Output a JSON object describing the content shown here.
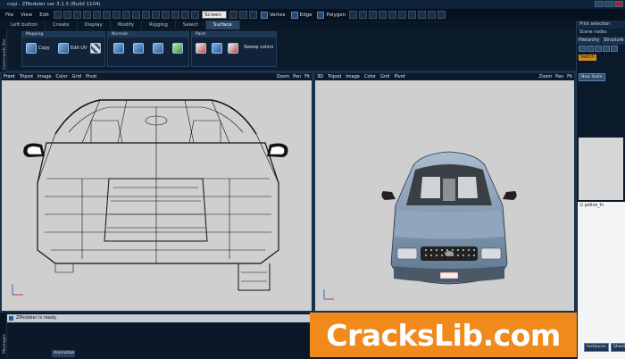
{
  "window": {
    "title": "cvpi - ZModeler ver 3.1.5 (Build 1104)"
  },
  "menu": {
    "items": [
      "File",
      "View",
      "Edit"
    ],
    "select_value": "Screen",
    "modes": [
      "Vertex",
      "Edge",
      "Polygon"
    ]
  },
  "tabs": {
    "items": [
      "Create",
      "Display",
      "Modify",
      "Rigging",
      "Select",
      "Surface"
    ],
    "active": "Surface",
    "left_button": "Left button"
  },
  "ribbon": {
    "mapping_title": "Mapping",
    "normals_title": "Normals",
    "paint_title": "Paint",
    "copy_label": "Copy",
    "edit_uv_label": "Edit UV",
    "sweep_colors_label": "Sweep colors"
  },
  "left_strip_label": "Commands Bar",
  "viewports": [
    {
      "name": "Front",
      "items": [
        "Tripod",
        "Image",
        "Color",
        "Grid",
        "Pivot"
      ],
      "right_items": [
        "Zoom",
        "Pan",
        "Fit"
      ]
    },
    {
      "name": "3D",
      "items": [
        "Tripod",
        "Image",
        "Color",
        "Grid",
        "Pivot"
      ],
      "right_items": [
        "Zoom",
        "Pan",
        "Fit"
      ]
    }
  ],
  "right_panel": {
    "top_button": "Print selection",
    "title": "Scene nodes browser",
    "tabs": [
      "Hierarchy",
      "Structure"
    ],
    "switch_label": "Switch",
    "new_state_label": "New State",
    "tree_item": "police_hi",
    "bottom_tabs": [
      "Instances",
      "Sheets"
    ]
  },
  "status": {
    "text": "ZModeler is ready."
  },
  "bottom": {
    "animation_tab": "Animation",
    "messages_label": "Messages"
  },
  "watermark": {
    "text": "CracksLib.com"
  },
  "colors": {
    "accent": "#f08a1c",
    "chrome": "#0b1a2c",
    "viewport": "#cfcfcf"
  }
}
